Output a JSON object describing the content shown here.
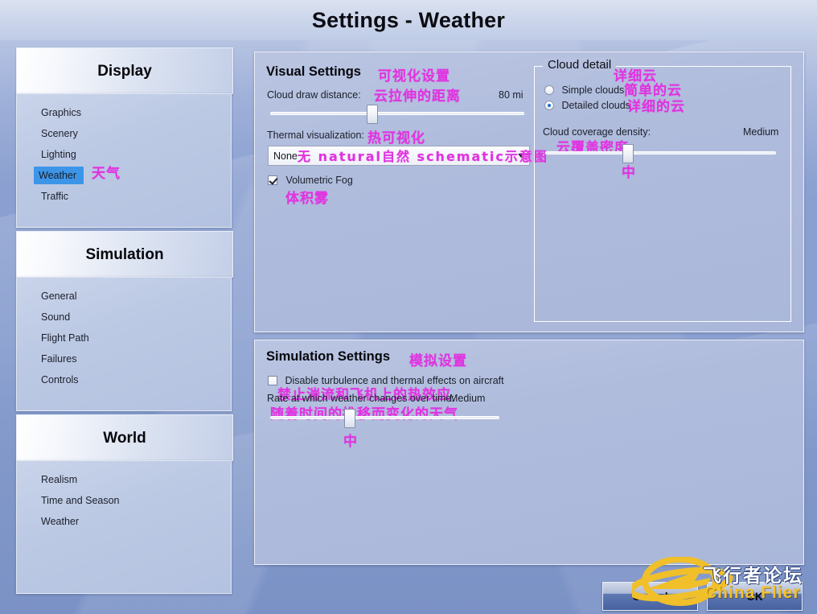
{
  "window": {
    "title": "Settings - Weather"
  },
  "sidebar": {
    "groups": [
      {
        "header": "Display",
        "items": [
          {
            "label": "Graphics",
            "selected": false
          },
          {
            "label": "Scenery",
            "selected": false
          },
          {
            "label": "Lighting",
            "selected": false
          },
          {
            "label": "Weather",
            "selected": true,
            "annotation": "天气"
          },
          {
            "label": "Traffic",
            "selected": false
          }
        ]
      },
      {
        "header": "Simulation",
        "items": [
          {
            "label": "General",
            "selected": false
          },
          {
            "label": "Sound",
            "selected": false
          },
          {
            "label": "Flight Path",
            "selected": false
          },
          {
            "label": "Failures",
            "selected": false
          },
          {
            "label": "Controls",
            "selected": false
          }
        ]
      },
      {
        "header": "World",
        "items": [
          {
            "label": "Realism",
            "selected": false
          },
          {
            "label": "Time and Season",
            "selected": false
          },
          {
            "label": "Weather",
            "selected": false
          }
        ]
      }
    ]
  },
  "visual_settings": {
    "title": "Visual Settings",
    "title_annotation": "可视化设置",
    "cloud_draw_distance": {
      "label": "Cloud draw distance:",
      "annotation": "云拉伸的距离",
      "value": "80 mi",
      "slider_percent": 40
    },
    "thermal_visualization": {
      "label": "Thermal visualization:",
      "annotation": "热可视化",
      "value": "None",
      "option_annotations": "无  natural自然 schematic示意图"
    },
    "volumetric_fog": {
      "label": "Volumetric Fog",
      "annotation": "体积雾",
      "checked": true
    }
  },
  "cloud_detail": {
    "legend": "Cloud detail",
    "legend_annotation": "详细云",
    "options": [
      {
        "label": "Simple clouds",
        "annotation": "简单的云",
        "selected": false
      },
      {
        "label": "Detailed clouds",
        "annotation": "详细的云",
        "selected": true
      }
    ],
    "coverage_density": {
      "label": "Cloud coverage density:",
      "annotation": "云覆盖密度",
      "value": "Medium",
      "value_annotation": "中",
      "slider_percent": 37
    }
  },
  "simulation_settings": {
    "title": "Simulation Settings",
    "title_annotation": "模拟设置",
    "disable_turbulence": {
      "label": "Disable turbulence and thermal effects on aircraft",
      "annotation": "禁止湍流和飞机上的热效应",
      "checked": false
    },
    "weather_change_rate": {
      "label": "Rate at which weather changes over time:",
      "annotation": "随着时间的推移而变化的天气",
      "value": "Medium",
      "value_annotation": "中",
      "slider_percent": 34
    }
  },
  "footer": {
    "cancel_label": "Cancel",
    "ok_label": "OK"
  },
  "watermark": {
    "chinese": "飞行者论坛",
    "english": "China Flier"
  },
  "colors": {
    "accent": "#3d95e8",
    "annotation": "#e133e1",
    "panel": "#b0bcdc",
    "background": "#8ba0d0",
    "watermark_gold": "#f2c12c"
  }
}
